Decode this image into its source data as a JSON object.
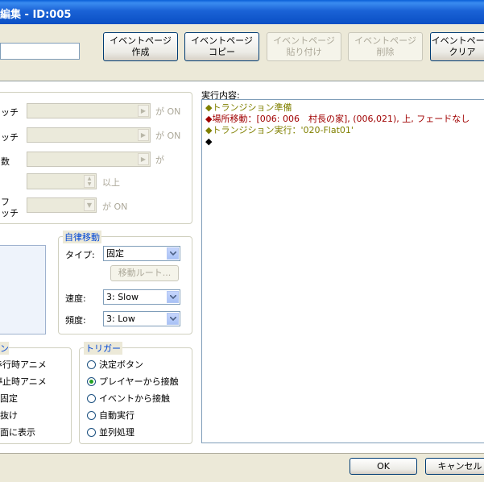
{
  "window": {
    "title": "編集 - ID:005"
  },
  "toolbar": {
    "create_label": "イベントページ\n作成",
    "copy_label": "イベントページ\nコピー",
    "paste_label": "イベントページ\n貼り付け",
    "delete_label": "イベントページ\n削除",
    "clear_label": "イベントページ\nクリア"
  },
  "conditions": {
    "switch1_suffix": "ッチ",
    "switch1_tail": "が ON",
    "switch2_suffix": "ッチ",
    "switch2_tail": "が ON",
    "variable_suffix": "数",
    "variable_tail": "が",
    "variable_value_tail": "以上",
    "self_switch_suffix_1": "フ",
    "self_switch_suffix_2": "ッチ",
    "self_switch_tail": "が ON"
  },
  "movement": {
    "legend": "自律移動",
    "type_label": "タイプ:",
    "type_value": "固定",
    "route_button": "移動ルート...",
    "speed_label": "速度:",
    "speed_value": "3: Slow",
    "freq_label": "頻度:",
    "freq_value": "3: Low"
  },
  "options": {
    "legend": "ン",
    "items": [
      "歩行時アニメ",
      "停止時アニメ",
      "向き固定",
      "すり抜け",
      "最前面に表示"
    ]
  },
  "trigger": {
    "legend": "トリガー",
    "items": [
      "決定ボタン",
      "プレイヤーから接触",
      "イベントから接触",
      "自動実行",
      "並列処理"
    ],
    "selected_index": 1
  },
  "contents": {
    "label": "実行内容:",
    "lines": [
      {
        "text": "◆トランジション準備",
        "color": "#808000"
      },
      {
        "text": "◆場所移動：[006: 006　村長の家], (006,021), 上, フェードなし",
        "color": "#a00000"
      },
      {
        "text": "◆トランジション実行：'020-Flat01'",
        "color": "#808000"
      },
      {
        "text": "◆",
        "color": "#000000"
      }
    ]
  },
  "footer": {
    "ok_label": "OK",
    "cancel_label": "キャンセル"
  }
}
